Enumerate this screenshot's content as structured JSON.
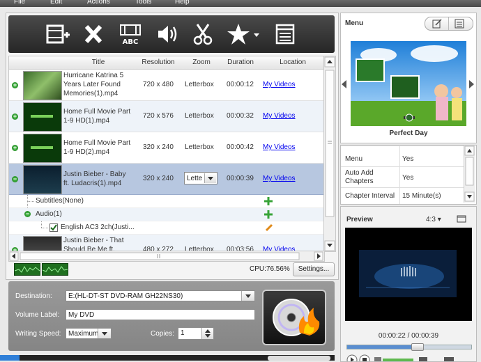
{
  "menubar": {
    "file": "File",
    "edit": "Edit",
    "actions": "Actions",
    "tools": "Tools",
    "help": "Help"
  },
  "table": {
    "headers": {
      "title": "Title",
      "resolution": "Resolution",
      "zoom": "Zoom",
      "duration": "Duration",
      "location": "Location"
    },
    "rows": [
      {
        "title_line1": "Hurricane Katrina 5",
        "title_line2": "Years Later Found",
        "title_line3": "Memories(1).mp4",
        "resolution": "720 x 480",
        "zoom": "Letterbox",
        "duration": "00:00:12",
        "location": "My Videos"
      },
      {
        "title_line1": "Home Full Movie Part",
        "title_line2": "1-9  HD(1).mp4",
        "resolution": "720 x 576",
        "zoom": "Letterbox",
        "duration": "00:00:32",
        "location": "My Videos"
      },
      {
        "title_line1": "Home Full Movie Part",
        "title_line2": "1-9  HD(2).mp4",
        "resolution": "320 x 240",
        "zoom": "Letterbox",
        "duration": "00:00:42",
        "location": "My Videos"
      },
      {
        "title_line1": "Justin Bieber - Baby",
        "title_line2": "ft. Ludacris(1).mp4",
        "resolution": "320 x 240",
        "zoom": "Lette",
        "duration": "00:00:39",
        "location": "My Videos"
      },
      {
        "title_line1": "Justin Bieber - That",
        "title_line2": "Should Be Me ft.",
        "resolution": "480 x 272",
        "zoom": "Letterbox",
        "duration": "00:03:56",
        "location": "My Videos"
      }
    ],
    "subtitles": "Subtitles(None)",
    "audio": "Audio(1)",
    "audio_track": "English AC3 2ch(Justi..."
  },
  "statusbar": {
    "cpu": "CPU:76.56%",
    "settings": "Settings..."
  },
  "bottom": {
    "destination_label": "Destination:",
    "destination_value": "E:(HL-DT-ST DVD-RAM GH22NS30)",
    "volume_label": "Volume Label:",
    "volume_value": "My DVD",
    "speed_label": "Writing Speed:",
    "speed_value": "Maximum",
    "copies_label": "Copies:",
    "copies_value": "1"
  },
  "menu_panel": {
    "title": "Menu",
    "template_name": "Perfect Day"
  },
  "props": [
    {
      "label": "Menu",
      "value": "Yes"
    },
    {
      "label": "Auto Add",
      "label2": "Chapters",
      "value": "Yes"
    },
    {
      "label": "Chapter Interval",
      "value": "15 Minute(s)"
    }
  ],
  "preview": {
    "title": "Preview",
    "aspect": "4:3",
    "time": "00:00:22 / 00:00:39",
    "progress": 0.56
  },
  "colors": {
    "accent": "#3c8c3c",
    "toolbar_bg": "#2e2e2e",
    "link": "#0000ee",
    "selected_row": "#b7c7e0"
  }
}
